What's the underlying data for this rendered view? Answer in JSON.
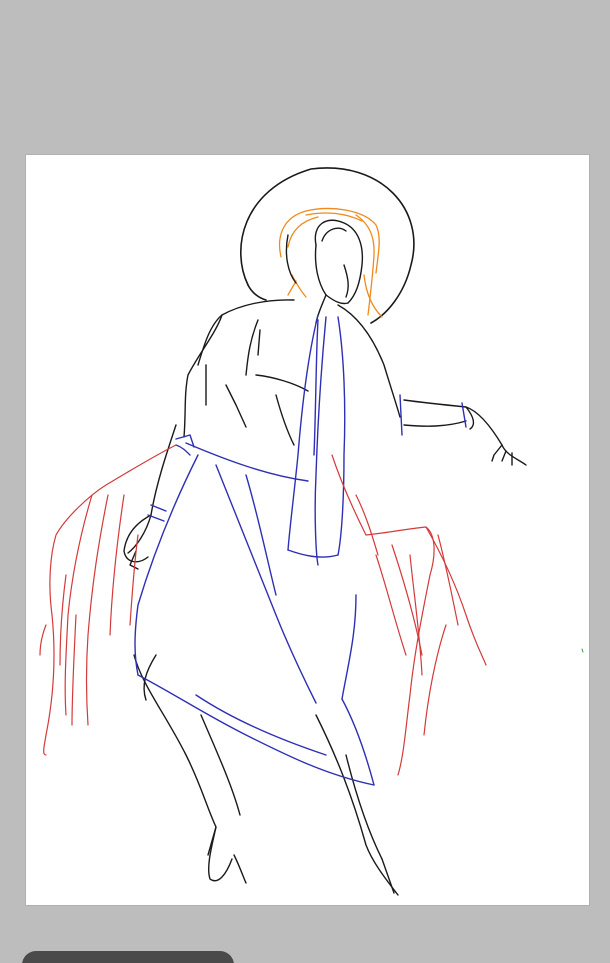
{
  "app": {
    "background_color": "#bdbdbd",
    "canvas_color": "#ffffff"
  },
  "artwork": {
    "subject": "sketch-figure-with-halo-and-wings",
    "line_colors": {
      "body": "#1a1a1a",
      "cloth": "#2f2fb5",
      "hair": "#f08a1c",
      "wings": "#d43a3a"
    }
  },
  "bottom_bar": {
    "chip_label": "",
    "chip_color": "#4a4a4a"
  }
}
